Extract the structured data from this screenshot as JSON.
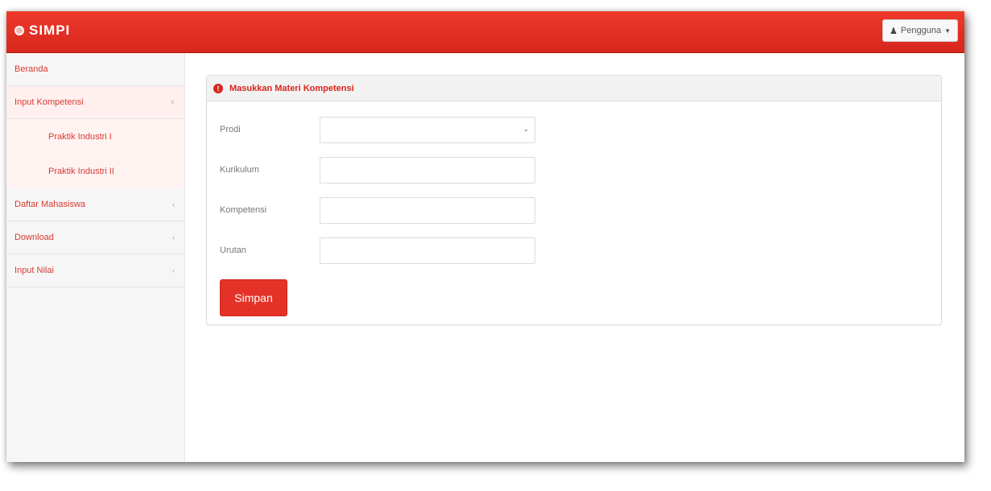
{
  "navbar": {
    "brand": "SIMPI",
    "user_menu_label": "Pengguna"
  },
  "sidebar": {
    "items": [
      {
        "label": "Beranda",
        "has_arrow": false
      },
      {
        "label": "Input Kompetensi",
        "has_arrow": true,
        "expanded": true,
        "children": [
          {
            "label": "Praktik Industri I"
          },
          {
            "label": "Praktik Industri II"
          }
        ]
      },
      {
        "label": "Daftar Mahasiswa",
        "has_arrow": true
      },
      {
        "label": "Download",
        "has_arrow": true
      },
      {
        "label": "Input Nilai",
        "has_arrow": true
      }
    ]
  },
  "panel": {
    "title": "Masukkan Materi Kompetensi",
    "fields": [
      {
        "label": "Prodi",
        "type": "select",
        "value": ""
      },
      {
        "label": "Kurikulum",
        "type": "text",
        "value": ""
      },
      {
        "label": "Kompetensi",
        "type": "text",
        "value": ""
      },
      {
        "label": "Urutan",
        "type": "text",
        "value": ""
      }
    ],
    "submit_label": "Simpan"
  },
  "colors": {
    "primary": "#d7261c",
    "link": "#d93a31"
  },
  "icons": {
    "brand": "gear-logo-icon",
    "user": "user-icon",
    "caret": "caret-down-icon",
    "info": "info-circle-icon",
    "chevron": "chevron-down-icon"
  }
}
